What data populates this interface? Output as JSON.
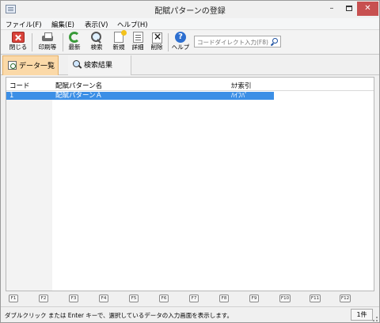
{
  "window": {
    "title": "配賦パターンの登録",
    "minimize": "–",
    "close": "✕"
  },
  "menu": [
    {
      "label": "ファイル(F)"
    },
    {
      "label": "編集(E)"
    },
    {
      "label": "表示(V)"
    },
    {
      "label": "ヘルプ(H)"
    }
  ],
  "toolbar": {
    "close_label": "閉じる",
    "print_label": "印刷等",
    "refresh_label": "最新",
    "search_label": "検索",
    "new_label": "新規",
    "detail_label": "詳細",
    "delete_label": "削除",
    "help_label": "ヘルプ",
    "help_glyph": "?",
    "code_direct_placeholder": "コードダイレクト入力(F8)"
  },
  "tabs": [
    {
      "label": "データ一覧",
      "active": true
    },
    {
      "label": "検索結果",
      "active": false
    }
  ],
  "grid": {
    "columns": [
      "コード",
      "配賦パターン名",
      "ｶﾅ索引"
    ],
    "rows": [
      {
        "code": "1",
        "name": "配賦パターンＡ",
        "kana": "ﾊｲﾌﾊﾟ"
      }
    ]
  },
  "function_keys": [
    "F1",
    "F2",
    "F3",
    "F4",
    "F5",
    "F6",
    "F7",
    "F8",
    "F9",
    "F10",
    "F11",
    "F12"
  ],
  "status": {
    "message": "ダブルクリック または Enter キーで、選択しているデータの入力画面を表示します。",
    "count": "1件"
  },
  "colors": {
    "selected_row": "#3c8fe6",
    "active_tab": "#fbd9a8",
    "close_button": "#c75050"
  }
}
